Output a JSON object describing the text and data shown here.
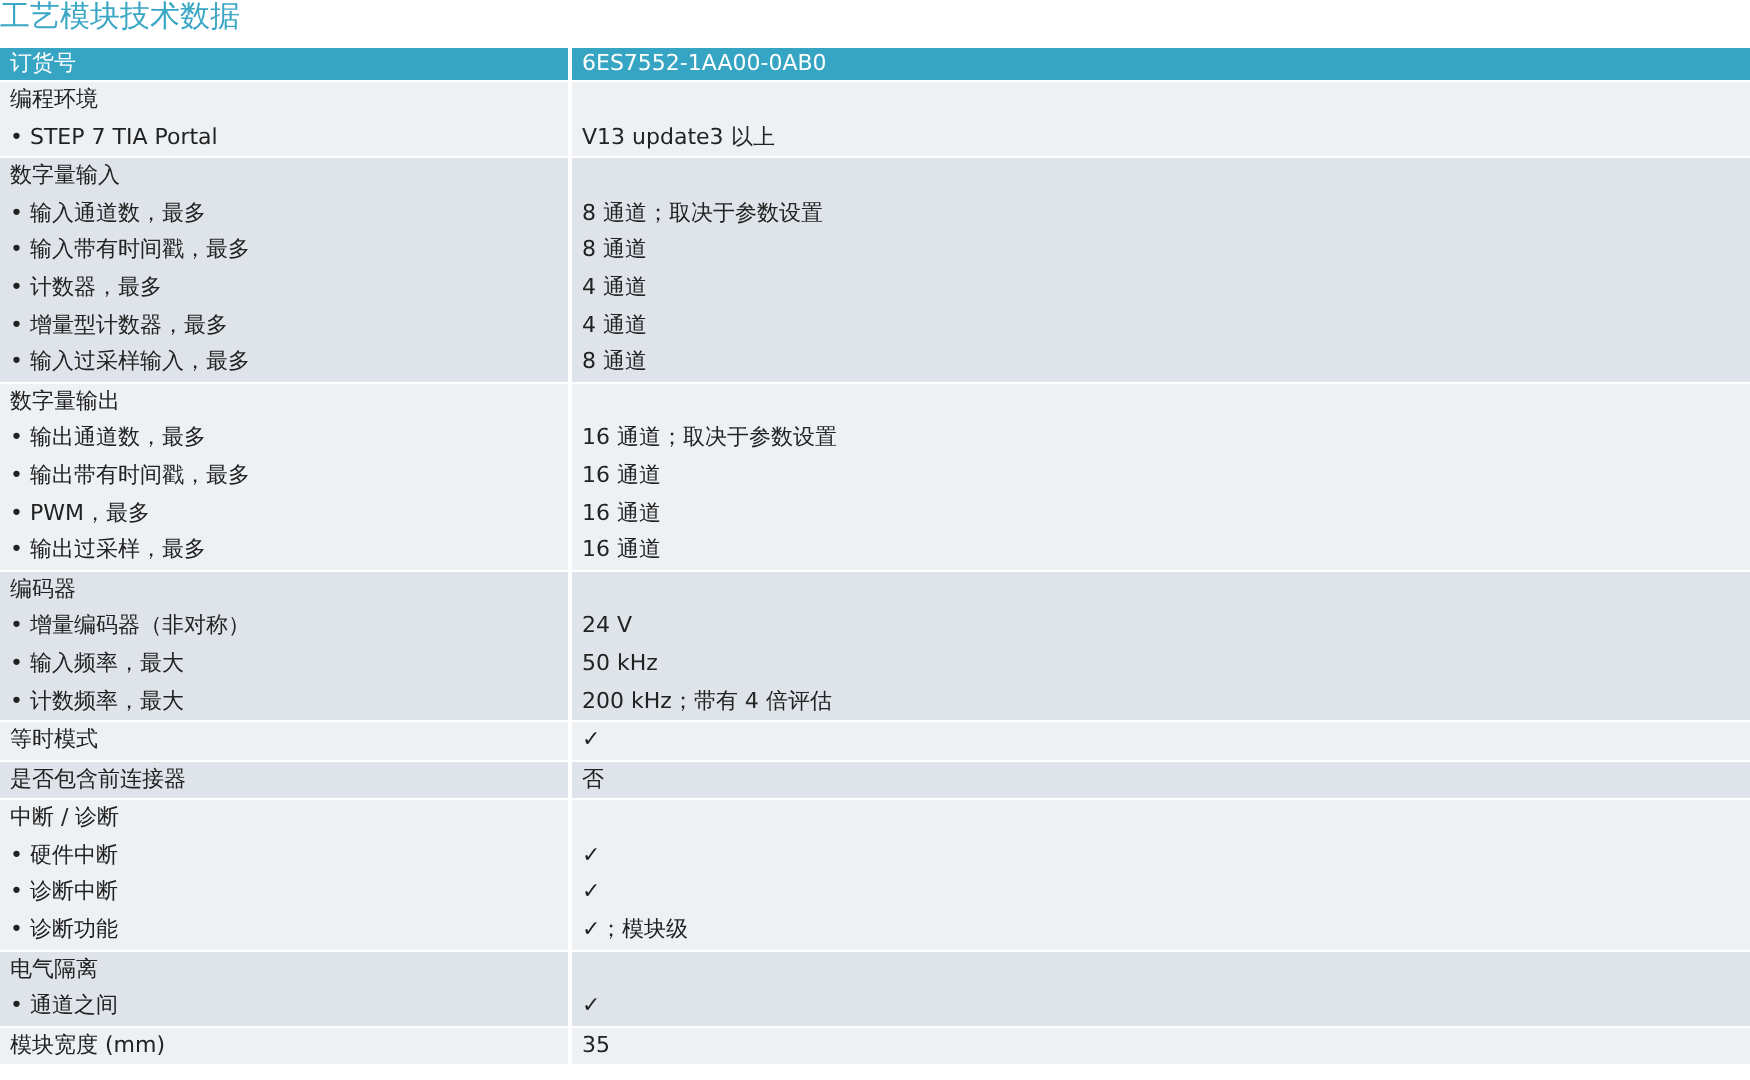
{
  "title": "工艺模块技术数据",
  "header": {
    "label": "订货号",
    "value": "6ES7552-1AA00-0AB0"
  },
  "groups": [
    {
      "rows": [
        {
          "label": "编程环境",
          "value": ""
        },
        {
          "label": "• STEP 7 TIA Portal",
          "value": "V13 update3 以上"
        }
      ]
    },
    {
      "rows": [
        {
          "label": "数字量输入",
          "value": ""
        },
        {
          "label": "• 输入通道数，最多",
          "value": "8 通道；取决于参数设置"
        },
        {
          "label": "• 输入带有时间戳，最多",
          "value": "8 通道"
        },
        {
          "label": "• 计数器，最多",
          "value": "4 通道"
        },
        {
          "label": "• 增量型计数器，最多",
          "value": "4 通道"
        },
        {
          "label": "• 输入过采样输入，最多",
          "value": "8 通道"
        }
      ]
    },
    {
      "rows": [
        {
          "label": "数字量输出",
          "value": ""
        },
        {
          "label": "• 输出通道数，最多",
          "value": "16 通道；取决于参数设置"
        },
        {
          "label": "• 输出带有时间戳，最多",
          "value": "16 通道"
        },
        {
          "label": "• PWM，最多",
          "value": "16 通道"
        },
        {
          "label": "• 输出过采样，最多",
          "value": "16 通道"
        }
      ]
    },
    {
      "rows": [
        {
          "label": "编码器",
          "value": ""
        },
        {
          "label": "• 增量编码器（非对称）",
          "value": "24 V"
        },
        {
          "label": "• 输入频率，最大",
          "value": "50 kHz"
        },
        {
          "label": "• 计数频率，最大",
          "value": "200 kHz；带有 4 倍评估"
        }
      ]
    },
    {
      "rows": [
        {
          "label": "等时模式",
          "value": "✓"
        }
      ]
    },
    {
      "rows": [
        {
          "label": "是否包含前连接器",
          "value": "否"
        }
      ]
    },
    {
      "rows": [
        {
          "label": "中断 / 诊断",
          "value": ""
        },
        {
          "label": "• 硬件中断",
          "value": "✓"
        },
        {
          "label": "• 诊断中断",
          "value": "✓"
        },
        {
          "label": "• 诊断功能",
          "value": "✓；模块级"
        }
      ]
    },
    {
      "rows": [
        {
          "label": "电气隔离",
          "value": ""
        },
        {
          "label": "• 通道之间",
          "value": "✓"
        }
      ]
    },
    {
      "rows": [
        {
          "label": "模块宽度 (mm)",
          "value": "35"
        }
      ]
    }
  ]
}
